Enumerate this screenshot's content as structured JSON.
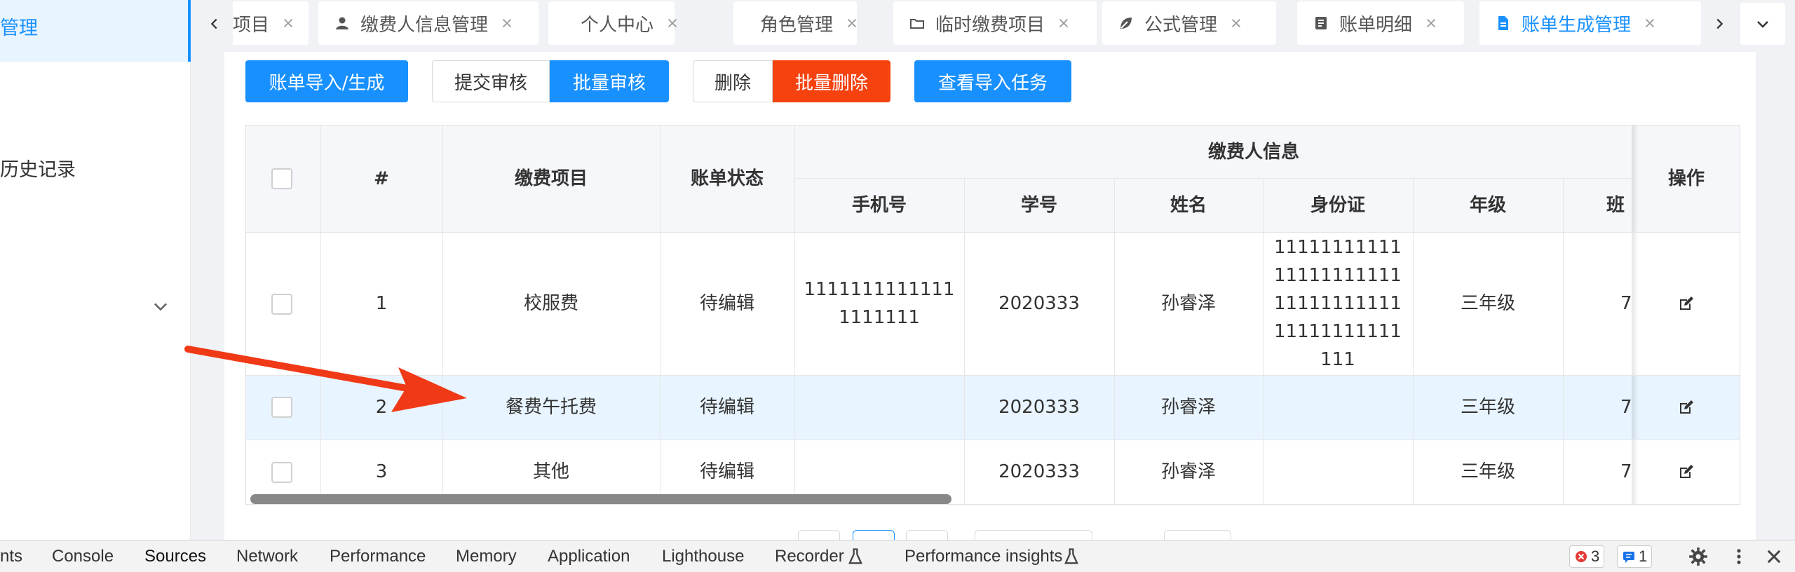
{
  "sidebar": {
    "active_item": "管理",
    "history_item": "历史记录"
  },
  "tabs": [
    {
      "label": "项目",
      "icon": "none"
    },
    {
      "label": "缴费人信息管理",
      "icon": "user-icon"
    },
    {
      "label": "个人中心",
      "icon": "none"
    },
    {
      "label": "角色管理",
      "icon": "none"
    },
    {
      "label": "临时缴费项目",
      "icon": "folder-icon"
    },
    {
      "label": "公式管理",
      "icon": "leaf-icon"
    },
    {
      "label": "账单明细",
      "icon": "list-icon"
    },
    {
      "label": "账单生成管理",
      "icon": "document-icon",
      "active": true
    }
  ],
  "toolbar": {
    "import_generate": "账单导入/生成",
    "submit_review": "提交审核",
    "batch_review": "批量审核",
    "delete": "删除",
    "batch_delete": "批量删除",
    "view_import_tasks": "查看导入任务"
  },
  "table": {
    "headers": {
      "index": "#",
      "item": "缴费项目",
      "status": "账单状态",
      "payer_group": "缴费人信息",
      "phone": "手机号",
      "student_no": "学号",
      "name": "姓名",
      "id_card": "身份证",
      "grade": "年级",
      "class": "班",
      "actions": "操作"
    },
    "rows": [
      {
        "index": "1",
        "item": "校服费",
        "status": "待编辑",
        "phone": "1111111111111\n1111111",
        "student_no": "2020333",
        "name": "孙睿泽",
        "id_card": "11111111111\n11111111111\n11111111111\n11111111111\n111",
        "grade": "三年级",
        "class": "7"
      },
      {
        "index": "2",
        "item": "餐费午托费",
        "status": "待编辑",
        "phone": "",
        "student_no": "2020333",
        "name": "孙睿泽",
        "id_card": "",
        "grade": "三年级",
        "class": "7"
      },
      {
        "index": "3",
        "item": "其他",
        "status": "待编辑",
        "phone": "",
        "student_no": "2020333",
        "name": "孙睿泽",
        "id_card": "",
        "grade": "三年级",
        "class": "7"
      }
    ]
  },
  "devtools": {
    "tabs": [
      "nts",
      "Console",
      "Sources",
      "Network",
      "Performance",
      "Memory",
      "Application",
      "Lighthouse",
      "Recorder",
      "Performance insights"
    ],
    "selected": "Sources",
    "error_count": "3",
    "message_count": "1"
  },
  "colors": {
    "primary": "#1890ff",
    "danger": "#f5420f",
    "row_highlight": "#e8f4ff",
    "annotation_arrow": "#f03a17"
  }
}
